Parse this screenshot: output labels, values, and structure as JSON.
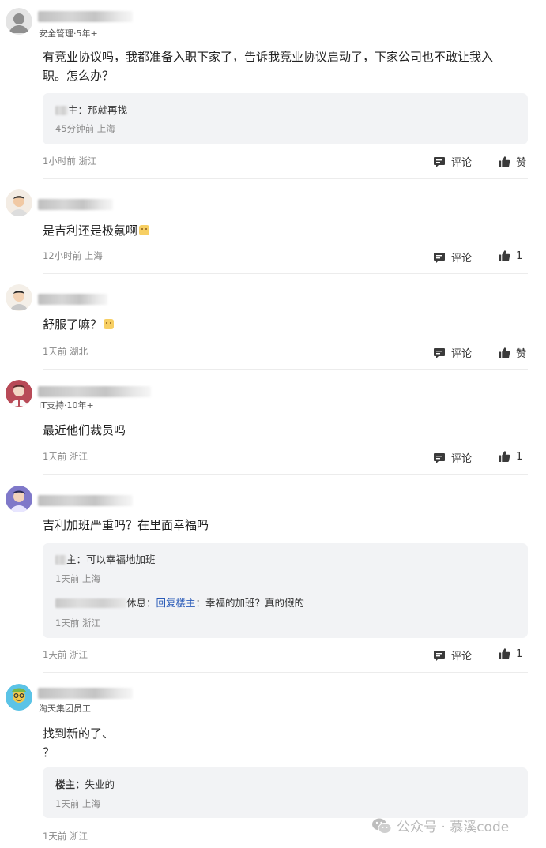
{
  "labels": {
    "comment": "评论",
    "like": "赞"
  },
  "comments": [
    {
      "tag": "安全管理·5年+",
      "lines": [
        "有竞业协议吗，我都准备入职下家了，告诉我竞业协议启动了，下家公司也不敢让我入",
        "职。怎么办？"
      ],
      "replies": [
        {
          "author_suffix": "主：",
          "text": "那就再找",
          "meta": "45分钟前 上海"
        }
      ],
      "meta": "1小时前 浙江",
      "likes": "赞"
    },
    {
      "tag": "",
      "lines": [
        "是吉利还是极氪啊"
      ],
      "meta": "12小时前 上海",
      "likes": "1"
    },
    {
      "tag": "",
      "lines": [
        "舒服了嘛？"
      ],
      "meta": "1天前 湖北",
      "likes": "赞"
    },
    {
      "tag": "IT支持·10年+",
      "lines": [
        "最近他们裁员吗"
      ],
      "meta": "1天前 浙江",
      "likes": "1"
    },
    {
      "tag": "",
      "lines": [
        "吉利加班严重吗？在里面幸福吗"
      ],
      "replies": [
        {
          "author_suffix": "主：",
          "text": "可以幸福地加班",
          "meta": "1天前 上海"
        },
        {
          "author_suffix": "休息：",
          "reply_to": "回复楼主",
          "text": "：幸福的加班？真的假的",
          "meta": "1天前 浙江"
        }
      ],
      "meta": "1天前 浙江",
      "likes": "1"
    },
    {
      "tag": "淘天集团员工",
      "lines": [
        "找到新的了、",
        "？"
      ],
      "replies": [
        {
          "author": "楼主：",
          "text": "失业的",
          "meta": "1天前 上海"
        }
      ],
      "meta": "1天前 浙江"
    }
  ],
  "watermark": "公众号 · 慕溪code",
  "colors": {
    "link": "#2a5bb8",
    "reply_bg": "#f2f3f5",
    "meta": "#8a8a8a"
  }
}
